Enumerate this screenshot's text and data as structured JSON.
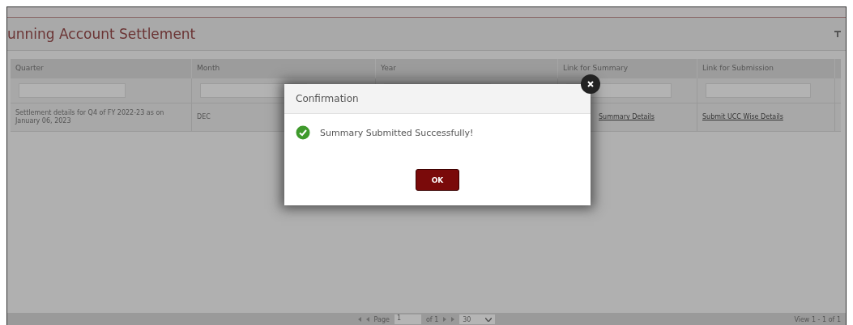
{
  "panel": {
    "title": "unning Account Settlement"
  },
  "table": {
    "columns": [
      "Quarter",
      "Month",
      "Year",
      "Link for Summary",
      "Link for Submission"
    ],
    "rows": [
      {
        "quarter": "Settlement details for Q4 of FY 2022-23 as on January 06, 2023",
        "month": "DEC",
        "summary_link": "Summary Details",
        "submission_link": "Submit UCC Wise Details"
      }
    ]
  },
  "pager": {
    "page_label": "Page",
    "page": "1",
    "of": "of 1",
    "rows": "30",
    "view": "View 1 - 1 of 1"
  },
  "dialog": {
    "title": "Confirmation",
    "message": "Summary Submitted Successfully!",
    "button": "OK"
  }
}
